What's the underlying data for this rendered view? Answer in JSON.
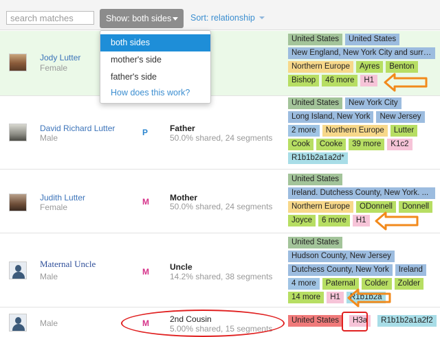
{
  "toolbar": {
    "search_placeholder": "search matches",
    "show_label": "Show: both sides",
    "sort_label": "Sort: relationship"
  },
  "dropdown": {
    "items": [
      "both sides",
      "mother's side",
      "father's side"
    ],
    "help": "How does this work?"
  },
  "rows": [
    {
      "name": "Jody Lutter",
      "gender": "Female",
      "tags": {
        "countries": [
          "United States",
          "United States"
        ],
        "region": "New England, New York City and surro...",
        "ancestry": "Northern Europe",
        "surnames": [
          "Ayres",
          "Benton",
          "Bishop"
        ],
        "more": "46 more",
        "mt": "H1"
      }
    },
    {
      "name": "David Richard Lutter",
      "gender": "Male",
      "side": "P",
      "relationship": "Father",
      "shared": "50.0% shared, 24 segments",
      "tags": {
        "countries": [
          "United States",
          "New York City"
        ],
        "regions": [
          "Long Island, New York",
          "New Jersey"
        ],
        "more_regions": "2 more",
        "ancestry": "Northern Europe",
        "surnames": [
          "Lutter",
          "Cook",
          "Cooke"
        ],
        "more": "39 more",
        "mt": "K1c2",
        "ydna": "R1b1b2a1a2d*"
      }
    },
    {
      "name": "Judith Lutter",
      "gender": "Female",
      "side": "M",
      "relationship": "Mother",
      "shared": "50.0% shared, 24 segments",
      "tags": {
        "country": "United States",
        "region": "Ireland. Dutchess County, New York. ...",
        "ancestry": "Northern Europe",
        "surnames": [
          "ODonnell",
          "Donnell",
          "Joyce"
        ],
        "more": "6 more",
        "mt": "H1"
      }
    },
    {
      "name": "Maternal Uncle",
      "gender": "Male",
      "side": "M",
      "relationship": "Uncle",
      "shared": "14.2% shared, 38 segments",
      "tags": {
        "country": "United States",
        "regions": [
          "Hudson County, New Jersey",
          "Dutchess County, New York",
          "Ireland"
        ],
        "more_regions": "4 more",
        "surnames": [
          "Paternal",
          "Colder",
          "Zolder"
        ],
        "more": "14 more",
        "mt": "H1",
        "ydna": "R1b1b2a"
      }
    },
    {
      "name": "",
      "gender": "Male",
      "side": "M",
      "relationship": "2nd Cousin",
      "shared": "5.00% shared, 15 segments",
      "tags": {
        "country": "United States",
        "mt": "H3a",
        "ydna": "R1b1b2a1a2f2"
      }
    }
  ],
  "colors": {
    "highlight_row": "#ebf9e8",
    "paternal": "#2c86cf",
    "maternal": "#d6338a",
    "annotation_orange": "#f28a1c",
    "annotation_red": "#e02020"
  }
}
